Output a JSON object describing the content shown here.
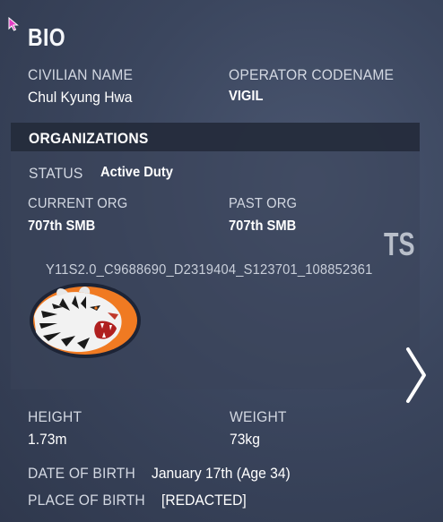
{
  "bio": {
    "title": "BIO",
    "civilian_name_label": "CIVILIAN NAME",
    "civilian_name": "Chul Kyung Hwa",
    "codename_label": "OPERATOR CODENAME",
    "codename": "VIGIL"
  },
  "organizations": {
    "header": "ORGANIZATIONS",
    "status_label": "STATUS",
    "status": "Active Duty",
    "current_org_label": "CURRENT ORG",
    "current_org": "707th SMB",
    "past_org_label": "PAST ORG",
    "past_org": "707th SMB",
    "corner_mark": "TS",
    "id_code": "Y11S2.0_C9688690_D2319404_S123701_108852361",
    "emblem_icon": "tiger-emblem-icon"
  },
  "physical": {
    "height_label": "HEIGHT",
    "height": "1.73m",
    "weight_label": "WEIGHT",
    "weight": "73kg",
    "dob_label": "DATE OF BIRTH",
    "dob": "January 17th (Age 34)",
    "pob_label": "PLACE OF BIRTH",
    "pob": "[REDACTED]"
  },
  "nav": {
    "next_icon": "chevron-right-icon"
  },
  "colors": {
    "background": "#3b465e",
    "panel": "#3a445a",
    "header_bar": "#222938",
    "emblem_orange": "#f07a22",
    "emblem_navy": "#1d2436"
  }
}
